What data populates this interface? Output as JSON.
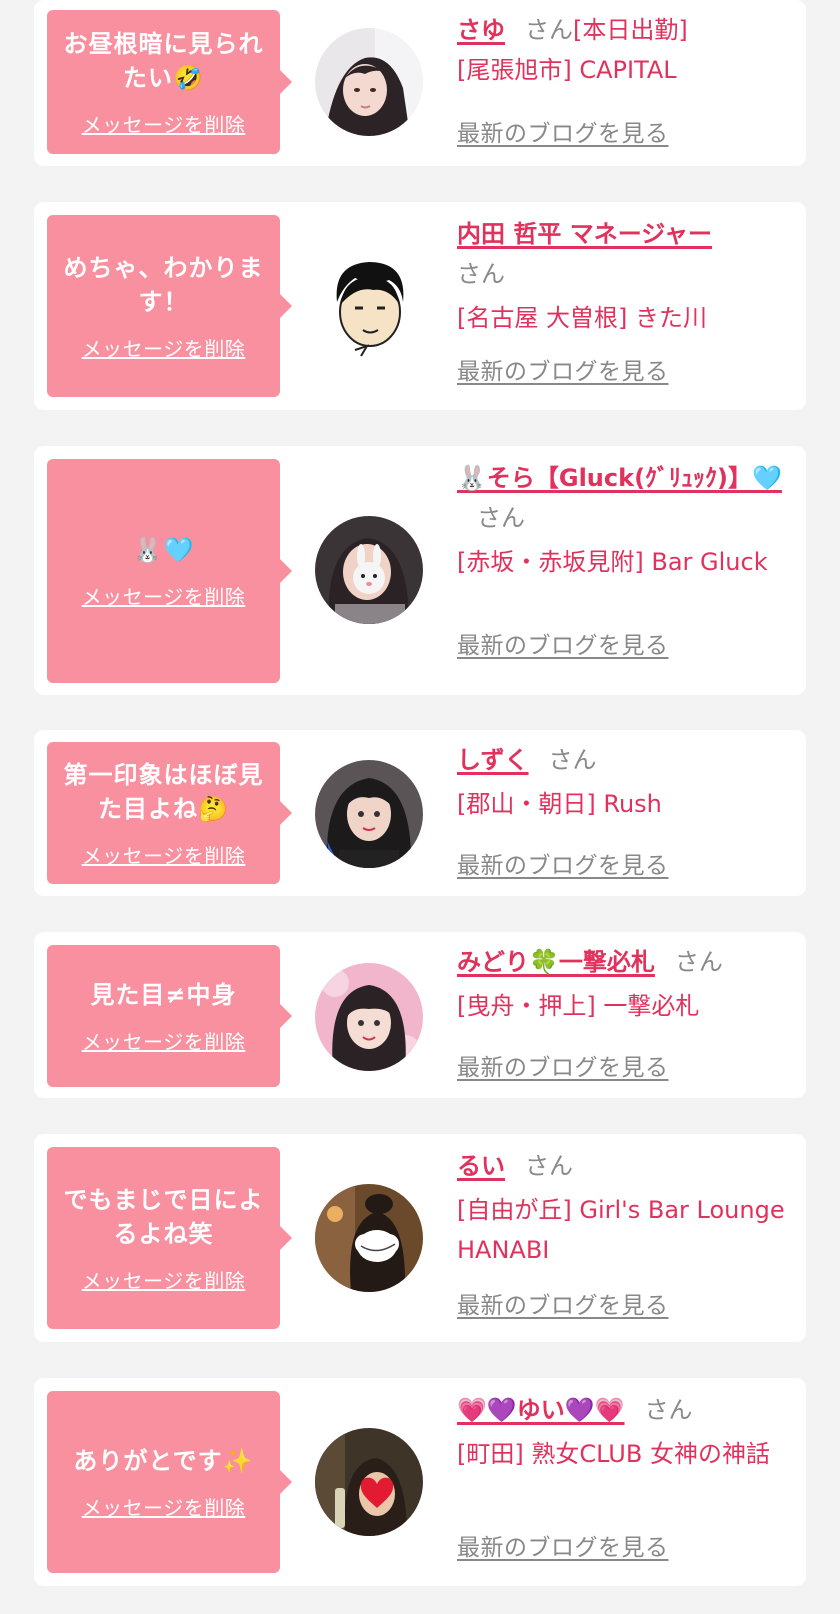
{
  "colors": {
    "background": "#f3f3f3",
    "card": "#ffffff",
    "bubble": "#f8909f",
    "accent": "#e0325c",
    "muted": "#888888"
  },
  "entries": [
    {
      "message": "お昼根暗に見られたい🤣",
      "delete_label": "メッセージを削除",
      "name": "さゆ",
      "honorific": "さん",
      "status": "[本日出勤]",
      "shop": "[尾張旭市] CAPITAL",
      "blog_label": "最新のブログを見る",
      "avatar_icon": "portrait-photo-icon"
    },
    {
      "message": "めちゃ、わかります！",
      "delete_label": "メッセージを削除",
      "name": "内田 哲平 マネージャー",
      "honorific": "さん",
      "status": "",
      "shop": "[名古屋 大曽根] きた川",
      "blog_label": "最新のブログを見る",
      "avatar_icon": "cartoon-man-illustration-icon"
    },
    {
      "message": "🐰🩵",
      "delete_label": "メッセージを削除",
      "name": "🐰そら【Gluck(ｸﾞﾘｭｯｸ)】🩵",
      "honorific": "さん",
      "status": "",
      "shop": "[赤坂・赤坂見附] Bar Gluck",
      "blog_label": "最新のブログを見る",
      "avatar_icon": "portrait-photo-icon"
    },
    {
      "message": "第一印象はほぼ見た目よね🤔",
      "delete_label": "メッセージを削除",
      "name": "しずく",
      "honorific": "さん",
      "status": "",
      "shop": "[郡山・朝日] Rush",
      "blog_label": "最新のブログを見る",
      "avatar_icon": "portrait-photo-icon"
    },
    {
      "message": "見た目≠中身",
      "delete_label": "メッセージを削除",
      "name": "みどり🍀一撃必札",
      "honorific": "さん",
      "status": "",
      "shop": "[曳舟・押上] 一撃必札",
      "blog_label": "最新のブログを見る",
      "avatar_icon": "portrait-photo-icon"
    },
    {
      "message": "でもまじで日によるよね笑",
      "delete_label": "メッセージを削除",
      "name": "るい",
      "honorific": "さん",
      "status": "",
      "shop": "[自由が丘] Girl's Bar Lounge HANABI",
      "blog_label": "最新のブログを見る",
      "avatar_icon": "portrait-photo-icon"
    },
    {
      "message": "ありがとです✨",
      "delete_label": "メッセージを削除",
      "name": "💗💜ゆい💜💗",
      "honorific": "さん",
      "status": "",
      "shop": "[町田] 熟女CLUB 女神の神話",
      "blog_label": "最新のブログを見る",
      "avatar_icon": "portrait-photo-icon"
    }
  ]
}
